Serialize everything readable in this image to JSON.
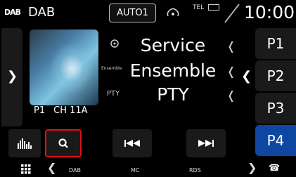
{
  "header": {
    "source_logo": "DAB",
    "source_title": "DAB",
    "auto_button": "AUTO1",
    "tel_label": "TEL",
    "clock": "10:00"
  },
  "now_playing": {
    "preset": "P1",
    "channel": "CH 11A",
    "service": "Service",
    "ensemble_tag": "Ensemble",
    "ensemble": "Ensemble",
    "pty_tag": "PTY",
    "pty": "PTY"
  },
  "presets": [
    "P1",
    "P2",
    "P3",
    "P4"
  ],
  "active_preset": "P4",
  "bottom_bar": {
    "tabs": [
      "DAB",
      "MC",
      "RDS"
    ]
  },
  "icons": {
    "left_arrow": "chevron-right-icon",
    "search": "search-icon",
    "eq": "equalizer-icon",
    "prev": "previous-track-icon",
    "next": "next-track-icon",
    "menu": "grid-menu-icon",
    "phone": "phone-icon"
  },
  "colors": {
    "active_preset": "#0d47a1",
    "highlight_border": "#dd1111"
  }
}
